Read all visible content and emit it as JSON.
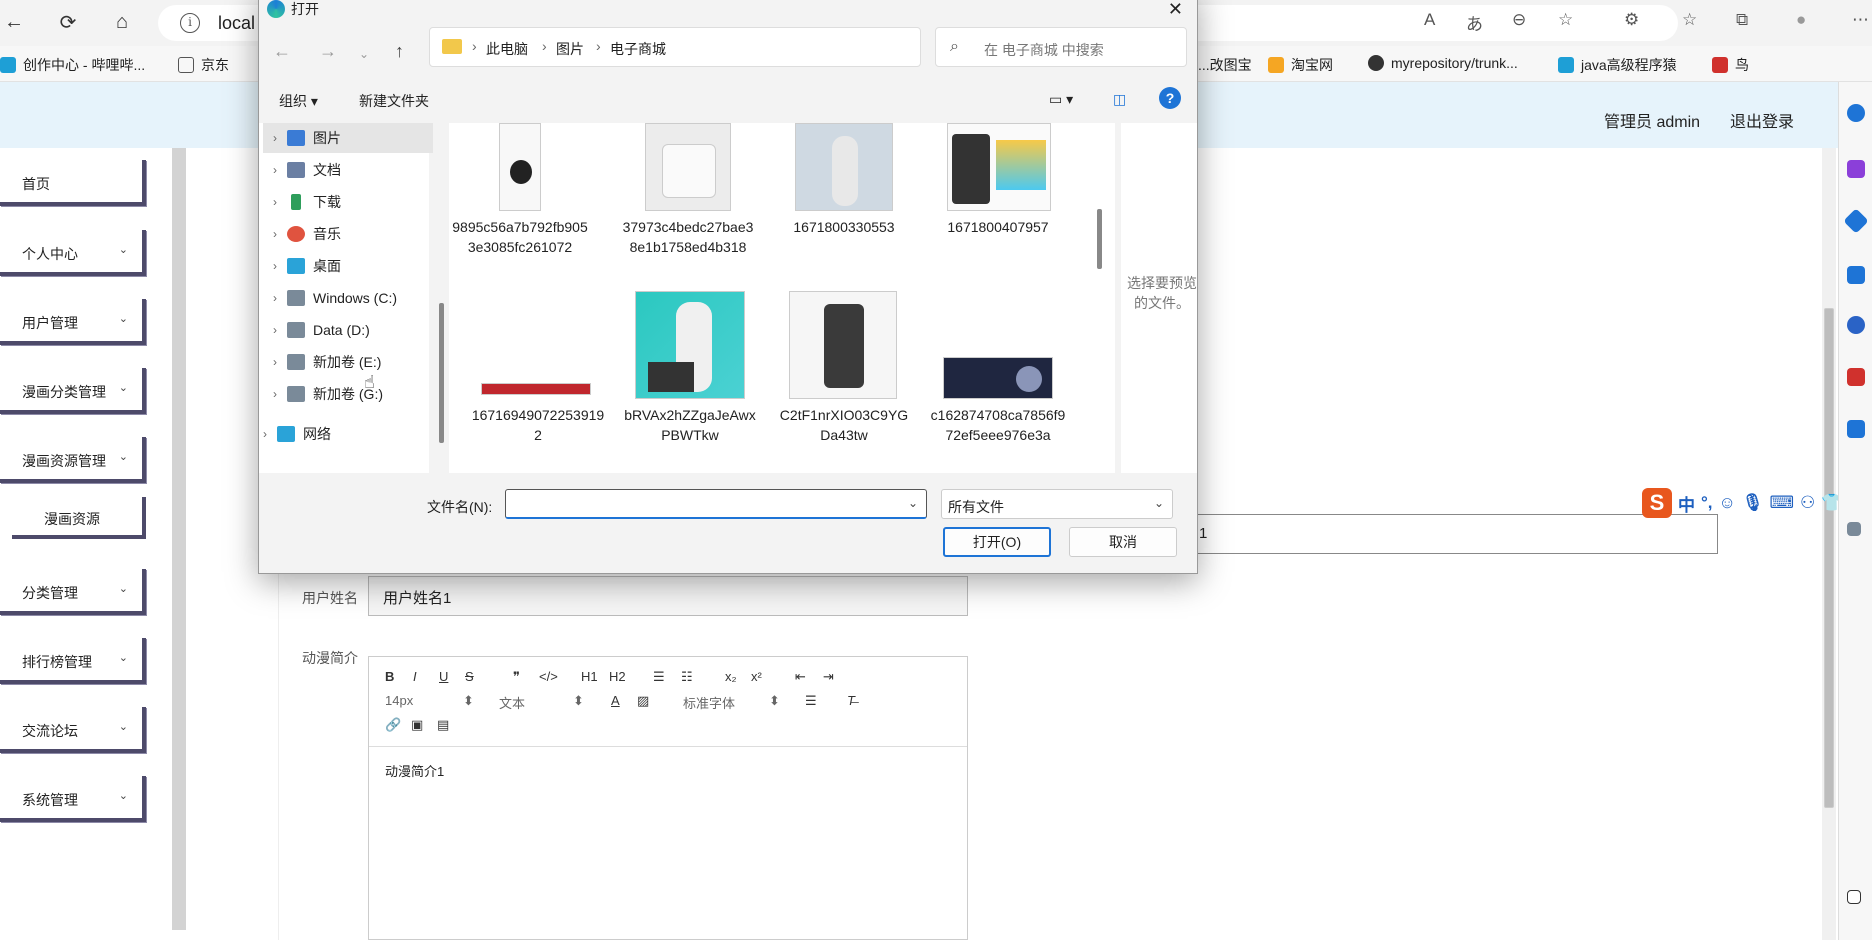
{
  "browser": {
    "url_partial": "local",
    "info_glyph": "i",
    "back": "←",
    "refresh": "⟳",
    "home": "⌂",
    "addr_icons": [
      "A",
      "あ",
      "⊖",
      "☆"
    ],
    "right_icons": [
      "⚙",
      "☆",
      "⧉",
      "●",
      "⋯"
    ]
  },
  "bookmarks": [
    {
      "label": "创作中心 - 哔哩哔...",
      "color": "#1e9fd6"
    },
    {
      "label": "京东",
      "color": "#cccccc"
    },
    {
      "label": "...改图宝",
      "color": "#ffffff"
    },
    {
      "label": "淘宝网",
      "color": "#f5a623"
    },
    {
      "label": "myrepository/trunk...",
      "color": "#333333"
    },
    {
      "label": "java高级程序猿",
      "color": "#1e9fd6"
    },
    {
      "label": "鸟",
      "color": "#d0312d"
    }
  ],
  "app": {
    "admin_label": "管理员 admin",
    "logout_label": "退出登录",
    "sidebar": [
      {
        "label": "首页",
        "chevron": ""
      },
      {
        "label": "个人中心",
        "chevron": "⌄"
      },
      {
        "label": "用户管理",
        "chevron": "⌄"
      },
      {
        "label": "漫画分类管理",
        "chevron": "⌄"
      },
      {
        "label": "漫画资源管理",
        "chevron": "⌄"
      },
      {
        "label": "分类管理",
        "chevron": "⌄"
      },
      {
        "label": "排行榜管理",
        "chevron": "⌄"
      },
      {
        "label": "交流论坛",
        "chevron": "⌄"
      },
      {
        "label": "系统管理",
        "chevron": "⌄"
      }
    ],
    "sidebar_sub": "漫画资源",
    "form": {
      "username_label": "用户姓名",
      "username_value": "用户姓名1",
      "intro_label": "动漫简介",
      "partial_value": "1",
      "editor_toolbar_row1": [
        "B",
        "I",
        "U",
        "S",
        "❞",
        "</>",
        "H1",
        "H2",
        "☰",
        "☷",
        "x₂",
        "x²",
        "⇤",
        "⇥"
      ],
      "editor_font_size": "14px",
      "editor_text_type": "文本",
      "editor_font": "标准字体",
      "editor_content": "动漫简介1"
    },
    "ime": {
      "logo": "S",
      "lang": "中",
      "punct": "°,"
    }
  },
  "dialog": {
    "title": "打开",
    "close": "✕",
    "breadcrumb": [
      "此电脑",
      "图片",
      "电子商城"
    ],
    "search_placeholder": "在 电子商城 中搜索",
    "organize": "组织 ▾",
    "new_folder": "新建文件夹",
    "help": "?",
    "tree": [
      {
        "label": "图片",
        "color": "#3a7bd5",
        "selected": true
      },
      {
        "label": "文档",
        "color": "#6b7fa3",
        "selected": false
      },
      {
        "label": "下载",
        "color": "#2e9e5b",
        "selected": false
      },
      {
        "label": "音乐",
        "color": "#e0533f",
        "selected": false
      },
      {
        "label": "桌面",
        "color": "#2aa3d8",
        "selected": false
      },
      {
        "label": "Windows (C:)",
        "color": "#7a8a99",
        "selected": false
      },
      {
        "label": "Data (D:)",
        "color": "#7a8a99",
        "selected": false
      },
      {
        "label": "新加卷 (E:)",
        "color": "#7a8a99",
        "selected": false
      },
      {
        "label": "新加卷 (G:)",
        "color": "#7a8a99",
        "selected": false
      },
      {
        "label": "网络",
        "color": "#2aa3d8",
        "selected": false
      }
    ],
    "files": [
      {
        "name": "9895c56a7b792fb9053e3085fc261072",
        "thumb": "watch"
      },
      {
        "name": "37973c4bedc27bae38e1b1758ed4b318",
        "thumb": "robot-vacuum"
      },
      {
        "name": "1671800330553",
        "thumb": "humanoid"
      },
      {
        "name": "1671800407957",
        "thumb": "tablet"
      },
      {
        "name": "167169490722539192",
        "thumb": "banner"
      },
      {
        "name": "bRVAx2hZZgaJeAwxPBWTkw",
        "thumb": "anime"
      },
      {
        "name": "C2tF1nrXIO03C9YGDa43tw",
        "thumb": "phone"
      },
      {
        "name": "c162874708ca7856f972ef5eee976e3a",
        "thumb": "dark-banner"
      }
    ],
    "preview_text": "选择要预览的文件。",
    "filename_label": "文件名(N):",
    "filename_value": "",
    "filetype": "所有文件",
    "open_btn": "打开(O)",
    "cancel_btn": "取消"
  }
}
